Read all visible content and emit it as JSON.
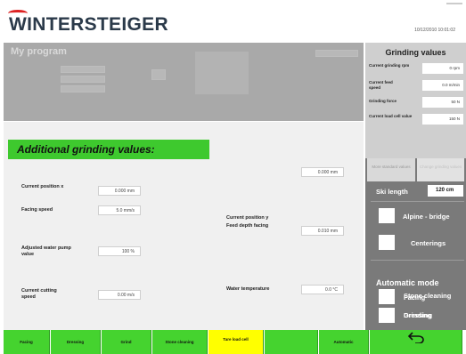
{
  "header": {
    "brand": "WINTERSTEIGER",
    "datetime": "10/12/2010 10:01:02"
  },
  "program": {
    "title": "My program"
  },
  "dialog": {
    "title": "Additional grinding values:",
    "fields": [
      {
        "label": "Current position x",
        "value": "0.000 mm"
      },
      {
        "label": "Facing speed",
        "value": "5.0 mm/s"
      },
      {
        "label": "Adjusted water pump value",
        "value": "100 %"
      },
      {
        "label": "Current cutting speed",
        "value": "0.00 m/s"
      },
      {
        "label": "Current position y",
        "value": "0.000 mm"
      },
      {
        "label": "Feed depth facing",
        "value": "0.010 mm"
      },
      {
        "label": "Water temperature",
        "value": "0.0 °C"
      }
    ]
  },
  "right_panel": {
    "title": "Grinding values",
    "values": [
      {
        "label": "Current grinding rpm",
        "value": "0 rpm"
      },
      {
        "label": "Current feed speed",
        "value": "0.0 m/min"
      },
      {
        "label": "Grinding force",
        "value": "50 N"
      },
      {
        "label": "Current load cell value",
        "value": "150 N"
      }
    ],
    "tabs": [
      {
        "label": "More standard values"
      },
      {
        "label": "Change grinding values"
      }
    ],
    "ski_length_label": "Ski length",
    "ski_length_value": "120 cm",
    "options": [
      {
        "label": "Alpine - bridge",
        "checked": false
      },
      {
        "label": "Centerings",
        "checked": false
      }
    ],
    "automatic_mode_title": "Automatic mode",
    "auto_options": [
      {
        "label": "Facing",
        "checked": false
      },
      {
        "label": "Dressing",
        "checked": false
      },
      {
        "label": "Stone cleaning",
        "checked": false
      },
      {
        "label": "Grinding",
        "checked": false
      }
    ]
  },
  "bottom_bar": {
    "buttons": [
      {
        "label": "Facing"
      },
      {
        "label": "Dressing"
      },
      {
        "label": "Grind"
      },
      {
        "label": "Stone cleaning"
      },
      {
        "label": "Tare load cell"
      },
      {
        "label": ""
      },
      {
        "label": "Automatic"
      }
    ],
    "back_icon": "back-arrow-icon"
  },
  "colors": {
    "accent_green": "#45d32f",
    "highlight_yellow": "#ffff00",
    "panel_grey": "#7a7a7a"
  }
}
